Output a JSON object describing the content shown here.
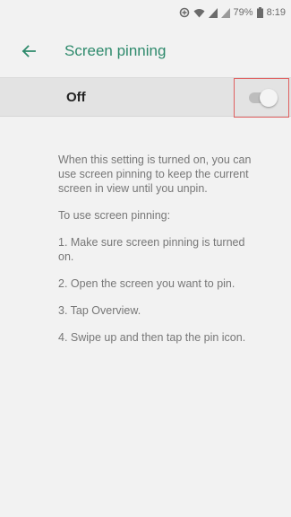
{
  "status_bar": {
    "battery_text": "79%",
    "time": "8:19",
    "icons": [
      "data-saver-icon",
      "wifi-icon",
      "signal-icon",
      "signal-icon",
      "battery-icon"
    ]
  },
  "app_bar": {
    "title": "Screen pinning",
    "back_icon": "arrow-back-icon"
  },
  "toggle": {
    "label": "Off",
    "state": "off"
  },
  "description": {
    "intro": "When this setting is turned on, you can use screen pinning to keep the current screen in view until you unpin.",
    "howto_heading": "To use screen pinning:",
    "step1": "1. Make sure screen pinning is turned on.",
    "step2": "2. Open the screen you want to pin.",
    "step3": "3. Tap Overview.",
    "step4": "4. Swipe up and then tap the pin icon."
  },
  "colors": {
    "accent": "#2e8a6c",
    "highlight_border": "#e06060",
    "background": "#f2f2f2"
  }
}
